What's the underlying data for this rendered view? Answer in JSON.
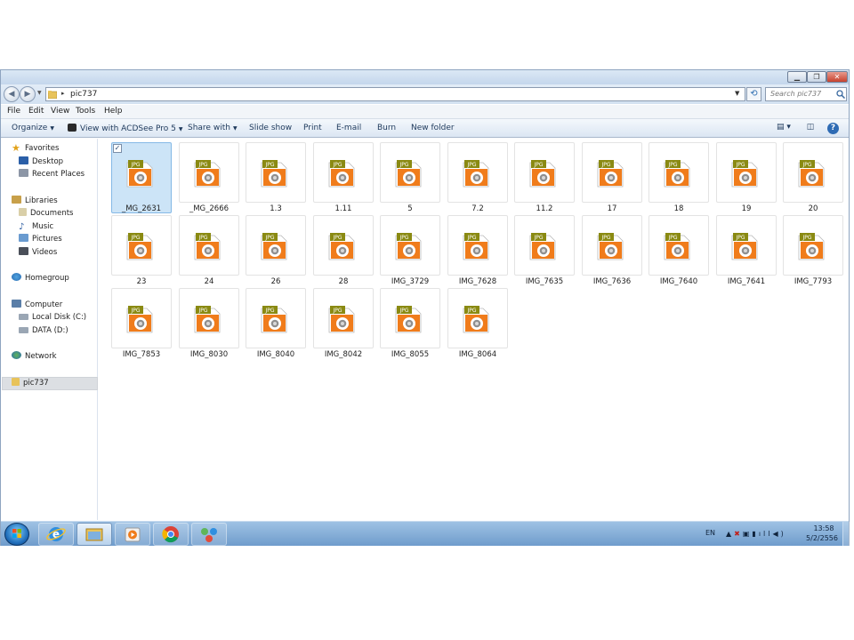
{
  "window": {
    "address_path": "pic737",
    "search_placeholder": "Search pic737"
  },
  "menubar": {
    "items": [
      "File",
      "Edit",
      "View",
      "Tools",
      "Help"
    ]
  },
  "toolbar": {
    "organize": "Organize",
    "view_with": "View with ACDSee Pro 5",
    "share_with": "Share with",
    "slide_show": "Slide show",
    "print": "Print",
    "email": "E-mail",
    "burn": "Burn",
    "new_folder": "New folder"
  },
  "nav": {
    "favorites": "Favorites",
    "desktop": "Desktop",
    "recent_places": "Recent Places",
    "libraries": "Libraries",
    "documents": "Documents",
    "music": "Music",
    "pictures": "Pictures",
    "videos": "Videos",
    "homegroup": "Homegroup",
    "computer": "Computer",
    "local_disk": "Local Disk (C:)",
    "data_disk": "DATA (D:)",
    "network": "Network",
    "current_folder": "pic737"
  },
  "files": [
    {
      "name": "_MG_2631",
      "type": "JPG",
      "selected": true
    },
    {
      "name": "_MG_2666",
      "type": "JPG"
    },
    {
      "name": "1.3",
      "type": "JPG"
    },
    {
      "name": "1.11",
      "type": "JPG"
    },
    {
      "name": "5",
      "type": "JPG"
    },
    {
      "name": "7.2",
      "type": "JPG"
    },
    {
      "name": "11.2",
      "type": "JPG"
    },
    {
      "name": "17",
      "type": "JPG"
    },
    {
      "name": "18",
      "type": "JPG"
    },
    {
      "name": "19",
      "type": "JPG"
    },
    {
      "name": "20",
      "type": "JPG"
    },
    {
      "name": "23",
      "type": "JPG"
    },
    {
      "name": "24",
      "type": "JPG"
    },
    {
      "name": "26",
      "type": "JPG"
    },
    {
      "name": "28",
      "type": "JPG"
    },
    {
      "name": "IMG_3729",
      "type": "JPG"
    },
    {
      "name": "IMG_7628",
      "type": "JPG"
    },
    {
      "name": "IMG_7635",
      "type": "JPG"
    },
    {
      "name": "IMG_7636",
      "type": "JPG"
    },
    {
      "name": "IMG_7640",
      "type": "JPG"
    },
    {
      "name": "IMG_7641",
      "type": "JPG"
    },
    {
      "name": "IMG_7793",
      "type": "JPG"
    },
    {
      "name": "IMG_7853",
      "type": "JPG"
    },
    {
      "name": "IMG_8030",
      "type": "JPG"
    },
    {
      "name": "IMG_8040",
      "type": "JPG"
    },
    {
      "name": "IMG_8042",
      "type": "JPG"
    },
    {
      "name": "IMG_8055",
      "type": "JPG"
    },
    {
      "name": "IMG_8064",
      "type": "JPG"
    }
  ],
  "taskbar": {
    "language": "EN",
    "time": "13:58",
    "date": "5/2/2556",
    "pinned": [
      "internet-explorer-icon",
      "windows-explorer-icon",
      "media-player-icon",
      "chrome-icon",
      "network-app-icon"
    ]
  },
  "colors": {
    "selection": "#cce4f7",
    "file_icon_orange": "#f07c1b",
    "file_icon_tag": "#8a8a12",
    "taskbar": "#6f9ccc"
  }
}
